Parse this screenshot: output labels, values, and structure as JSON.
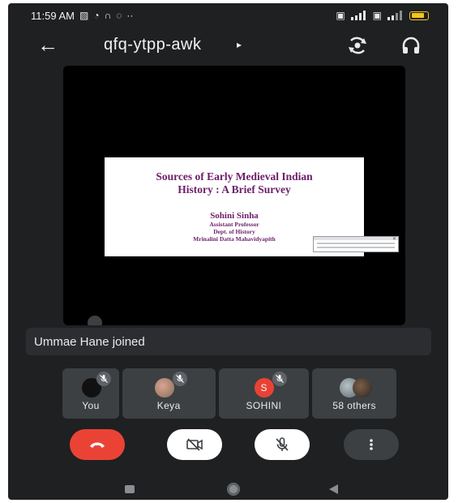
{
  "status_bar": {
    "time": "11:59 AM",
    "notification_icons": [
      "gallery-icon",
      "alarm-icon",
      "headphone-icon",
      "whatsapp-icon"
    ],
    "more_dots": "··",
    "signal_icons": [
      "volte-icon",
      "signal-icon",
      "volte-icon",
      "signal-icon"
    ],
    "battery_color": "#f5c518"
  },
  "header": {
    "meeting_code": "qfq-ytpp-awk",
    "chevron": "▸"
  },
  "shared_slide": {
    "title": "Sources of Early Medieval Indian\nHistory : A Brief Survey",
    "author": "Sohini Sinha",
    "lines": [
      "Assistant Professor",
      "Dept. of History",
      "Mrinalini Datta Mahavidyapith"
    ]
  },
  "toast": {
    "text": "Ummae Hane joined"
  },
  "participants": [
    {
      "name": "You",
      "muted": true
    },
    {
      "name": "Keya",
      "muted": true
    },
    {
      "name": "SOHINI",
      "initial": "S",
      "muted": true
    },
    {
      "name": "58 others",
      "muted": false
    }
  ],
  "controls": {
    "end_call_color": "#ea4335",
    "icons": [
      "end-call-icon",
      "video-off-icon",
      "mic-off-icon",
      "more-vert-icon"
    ]
  },
  "colors": {
    "background": "#1e2022",
    "tile": "#3c4043",
    "avatar_sohini": "#e94235"
  }
}
